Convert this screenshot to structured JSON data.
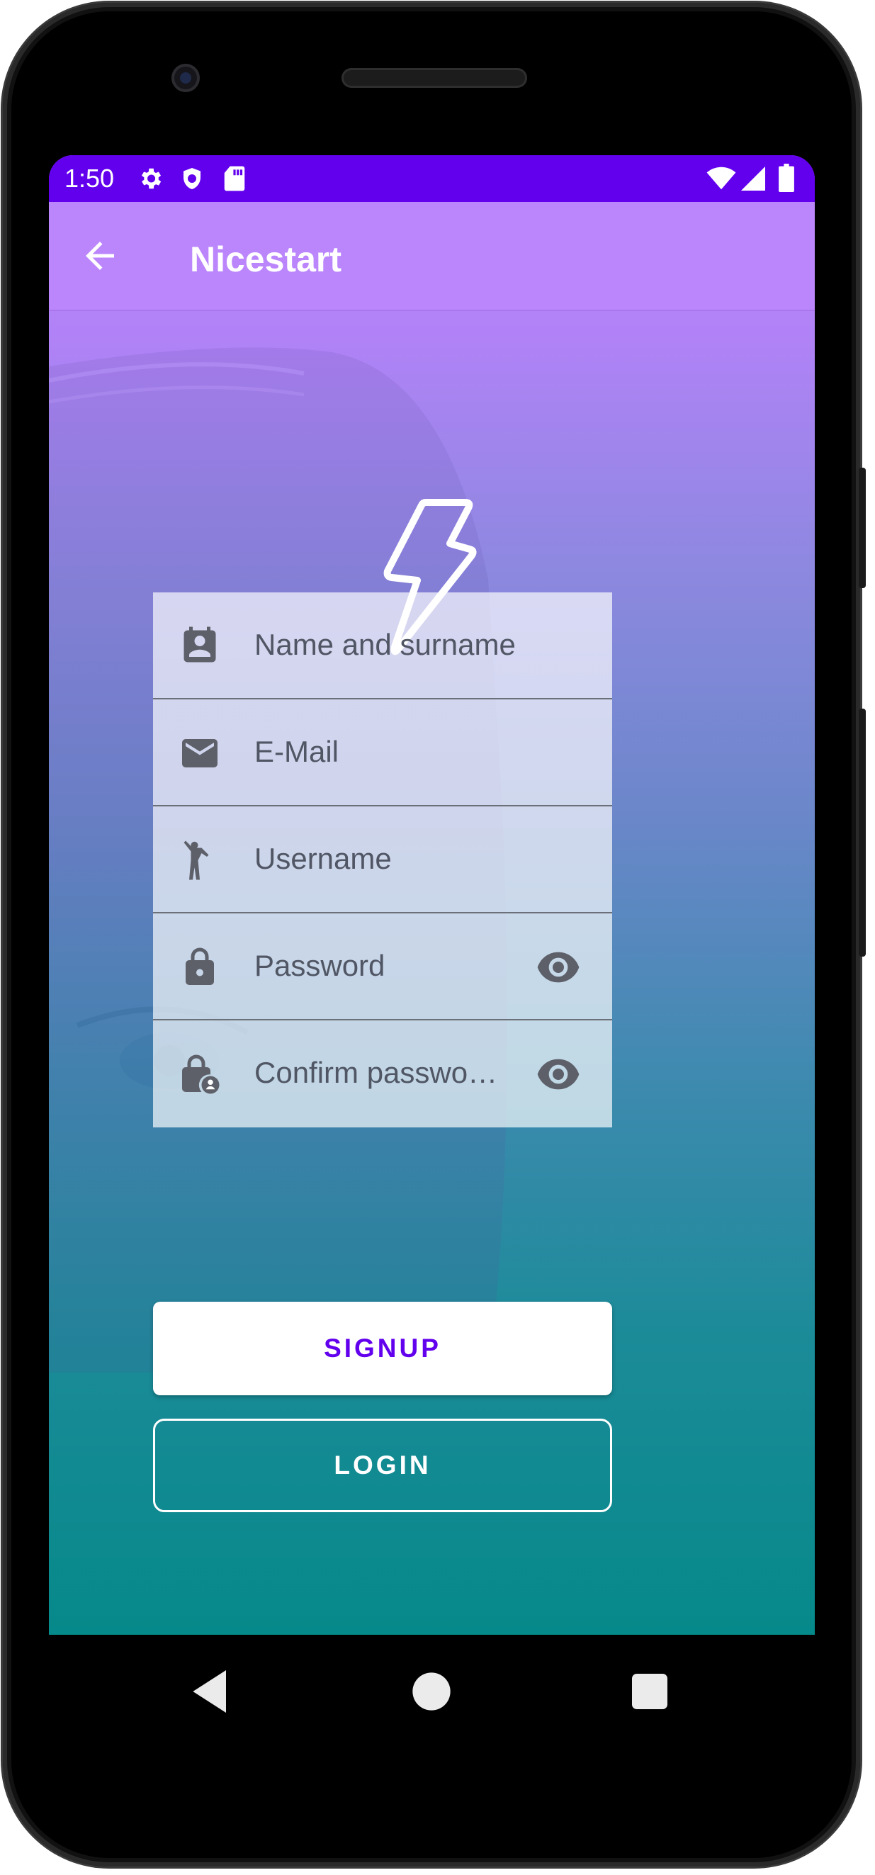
{
  "status_bar": {
    "time": "1:50",
    "background": "#6200ee",
    "icons_left": [
      "gear-icon",
      "shield-icon",
      "sd-card-icon"
    ],
    "icons_right": [
      "wifi-icon",
      "cell-signal-icon",
      "battery-icon"
    ]
  },
  "app_bar": {
    "title": "Nicestart",
    "background": "#bb86fc",
    "back_icon": "arrow-back-icon"
  },
  "logo": {
    "icon": "lightning-bolt-icon"
  },
  "form": {
    "fields": [
      {
        "label": "Name and surname",
        "icon": "contact-card-icon"
      },
      {
        "label": "E-Mail",
        "icon": "mail-icon"
      },
      {
        "label": "Username",
        "icon": "person-waving-icon"
      },
      {
        "label": "Password",
        "icon": "lock-icon",
        "trailing_icon": "eye-icon"
      },
      {
        "label": "Confirm passwo…",
        "icon": "lock-person-icon",
        "trailing_icon": "eye-icon"
      }
    ]
  },
  "buttons": {
    "signup_label": "SIGNUP",
    "login_label": "LOGIN",
    "accent": "#6200ee"
  },
  "navigation": {
    "icons": [
      "back-triangle-icon",
      "home-circle-icon",
      "recents-square-icon"
    ]
  }
}
